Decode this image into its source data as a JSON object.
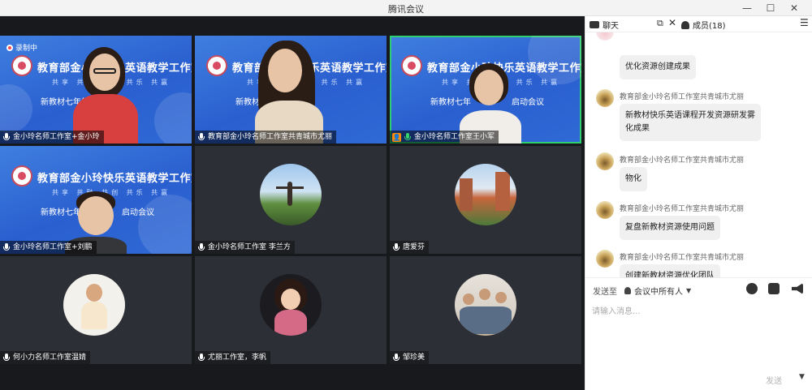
{
  "window": {
    "title": "腾讯会议",
    "min": "—",
    "max": "☐",
    "close": "✕"
  },
  "recording": {
    "label": "录制中"
  },
  "banner": {
    "title": "教育部金小玲快乐英语教学工作室",
    "motto": "共享 共融 共创 共乐 共赢",
    "subtitle_a": "新教材七年级",
    "subtitle_b": "启动会议",
    "subtitle_c": "新教材七",
    "subtitle_d": "新教材七年"
  },
  "participants": [
    {
      "name": "金小玲名师工作室+金小玲"
    },
    {
      "name": "教育部金小玲名师工作室共青城市尤丽"
    },
    {
      "name": "金小玲名师工作室王小军"
    },
    {
      "name": "金小玲名师工作室+刘鹏"
    },
    {
      "name": "金小玲名师工作室 李兰方"
    },
    {
      "name": "唐爱芬"
    },
    {
      "name": "何小力名师工作室温婧"
    },
    {
      "name": "尤丽工作室，李帆"
    },
    {
      "name": "邹珍美"
    }
  ],
  "panel": {
    "chat_tab": "聊天",
    "popout": "⧉",
    "close": "✕",
    "members_tab": "成员(18)",
    "menu": "☰"
  },
  "messages": [
    {
      "sender": "",
      "text": "优化资源创建成果"
    },
    {
      "sender": "教育部金小玲名师工作室共青城市尤丽",
      "text_line1": "新教材快乐英语课程开发资源研发雾",
      "text_line2": "化成果"
    },
    {
      "sender": "教育部金小玲名师工作室共青城市尤丽",
      "text": "物化"
    },
    {
      "sender": "教育部金小玲名师工作室共青城市尤丽",
      "text": "复盘新教材资源使用问题"
    },
    {
      "sender": "教育部金小玲名师工作室共青城市尤丽",
      "text": "创建新教材资源优化团队"
    }
  ],
  "composer": {
    "send_to_label": "发送至",
    "target": "会议中所有人",
    "placeholder": "请输入消息...",
    "send_label": "发送"
  },
  "icons": {
    "chat": "chat-icon",
    "members": "members-icon",
    "emoji": "emoji-icon",
    "file": "folder-icon",
    "announce": "megaphone-icon"
  },
  "colors": {
    "active_speaker_border": "#2fce72",
    "banner_blue": "#2f6ad6",
    "recording": "#ff4b4b",
    "host_badge": "#ff8a00"
  }
}
